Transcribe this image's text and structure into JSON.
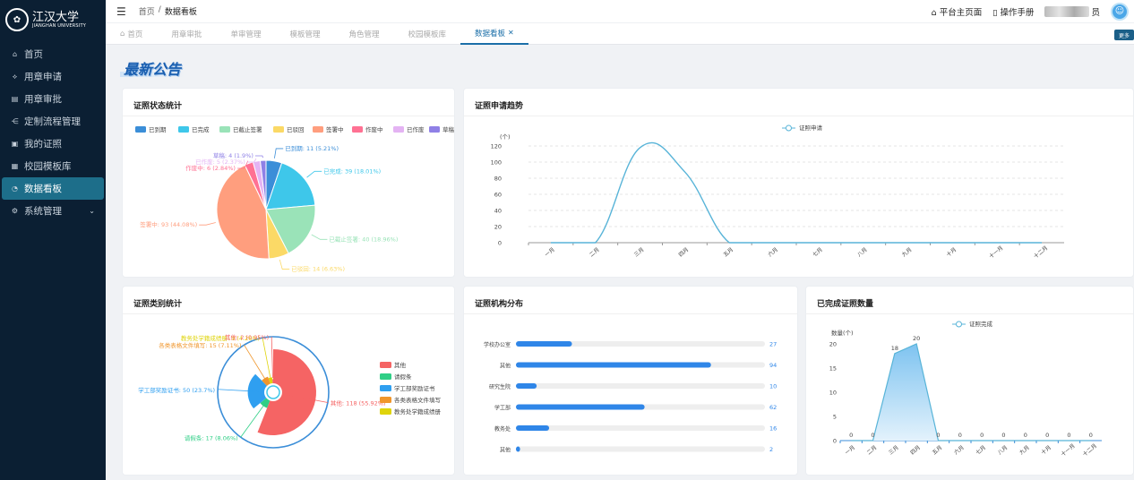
{
  "brand": {
    "name": "江汉大学",
    "sub": "JIANGHAN UNIVERSITY"
  },
  "sidebar": {
    "items": [
      {
        "label": "首页",
        "icon": "home-icon"
      },
      {
        "label": "用章申请",
        "icon": "stamp-icon"
      },
      {
        "label": "用章审批",
        "icon": "document-check-icon"
      },
      {
        "label": "定制流程管理",
        "icon": "flow-icon"
      },
      {
        "label": "我的证照",
        "icon": "certificate-icon"
      },
      {
        "label": "校园模板库",
        "icon": "template-icon"
      },
      {
        "label": "数据看板",
        "icon": "dashboard-icon"
      },
      {
        "label": "系统管理",
        "icon": "gear-icon"
      }
    ]
  },
  "header": {
    "breadcrumb": [
      "首页",
      "/",
      "数据看板"
    ],
    "home_link": "平台主页面",
    "manual_link": "操作手册",
    "user_suffix": "员"
  },
  "tabs": [
    "首页",
    "用章审批",
    "单审管理",
    "模板管理",
    "角色管理",
    "校园模板库",
    "数据看板"
  ],
  "more_label": "更多",
  "page_title": "最新公告",
  "cards": {
    "status": "证照状态统计",
    "trend": "证照申请趋势",
    "category": "证照类别统计",
    "org": "证照机构分布",
    "done": "已完成证照数量"
  },
  "chart_data": [
    {
      "type": "pie",
      "title": "证照状态统计",
      "legend": [
        "已到期",
        "已完成",
        "已截止签署",
        "已驳回",
        "签署中",
        "作废中",
        "已作废",
        "草稿"
      ],
      "colors": [
        "#3b8ed8",
        "#3ec7ea",
        "#9ae3b8",
        "#fbd966",
        "#ff9e7e",
        "#ff7193",
        "#e4b3f3",
        "#8f80e6"
      ],
      "slices": [
        {
          "name": "已到期",
          "value": 11,
          "pct": "5.21%"
        },
        {
          "name": "已完成",
          "value": 39,
          "pct": "18.01%"
        },
        {
          "name": "已截止签署",
          "value": 40,
          "pct": "18.96%"
        },
        {
          "name": "已驳回",
          "value": 14,
          "pct": "6.63%"
        },
        {
          "name": "签署中",
          "value": 93,
          "pct": "44.08%"
        },
        {
          "name": "作废中",
          "value": 6,
          "pct": "2.84%"
        },
        {
          "name": "已作废",
          "value": 5,
          "pct": "2.37%"
        },
        {
          "name": "草稿",
          "value": 4,
          "pct": "1.9%"
        }
      ]
    },
    {
      "type": "line",
      "title": "证照申请趋势",
      "series": [
        {
          "name": "证照申请",
          "values": [
            0,
            0,
            118,
            88,
            0,
            0,
            0,
            0,
            0,
            0,
            0,
            0
          ]
        }
      ],
      "categories": [
        "一月",
        "二月",
        "三月",
        "四月",
        "五月",
        "六月",
        "七月",
        "八月",
        "九月",
        "十月",
        "十一月",
        "十二月"
      ],
      "yunit": "(个)",
      "ylim": [
        0,
        120
      ],
      "yticks": [
        0,
        20,
        40,
        60,
        80,
        100,
        120
      ],
      "color": "#58b4d8"
    },
    {
      "type": "pie",
      "subtype": "rose",
      "title": "证照类别统计",
      "legend": [
        "其他",
        "请假条",
        "学工部奖励证书",
        "各类表格文件填写",
        "教务处学籍成绩册"
      ],
      "colors": [
        "#f56464",
        "#2fcf86",
        "#2f9ff0",
        "#f0962c",
        "#dfd40b"
      ],
      "slices": [
        {
          "name": "其他",
          "value": 118,
          "pct": "55.92%"
        },
        {
          "name": "请假条",
          "value": 17,
          "pct": "8.06%"
        },
        {
          "name": "学工部奖励证书",
          "value": 50,
          "pct": "23.7%"
        },
        {
          "name": "各类表格文件填写",
          "value": 15,
          "pct": "7.11%"
        },
        {
          "name": "教务处学籍成绩册",
          "value": 9,
          "pct": "4.26%"
        },
        {
          "name": "其他",
          "value": 2,
          "pct": "0.95%"
        }
      ]
    },
    {
      "type": "bar",
      "orientation": "horizontal",
      "title": "证照机构分布",
      "categories": [
        "学校办公室",
        "其他",
        "研究生院",
        "学工部",
        "教务处",
        "其他"
      ],
      "values": [
        27,
        94,
        10,
        62,
        16,
        2
      ],
      "xlim": [
        0,
        120
      ],
      "color": "#2f86e8"
    },
    {
      "type": "area",
      "title": "已完成证照数量",
      "series": [
        {
          "name": "证照完成",
          "values": [
            0,
            0,
            18,
            20,
            0,
            0,
            0,
            0,
            0,
            0,
            0,
            0
          ]
        }
      ],
      "categories": [
        "一月",
        "二月",
        "三月",
        "四月",
        "五月",
        "六月",
        "七月",
        "八月",
        "九月",
        "十月",
        "十一月",
        "十二月"
      ],
      "ylabel": "数量(个)",
      "ylim": [
        0,
        20
      ],
      "yticks": [
        0,
        5,
        10,
        15,
        20
      ],
      "color": "#58b4d8"
    }
  ]
}
